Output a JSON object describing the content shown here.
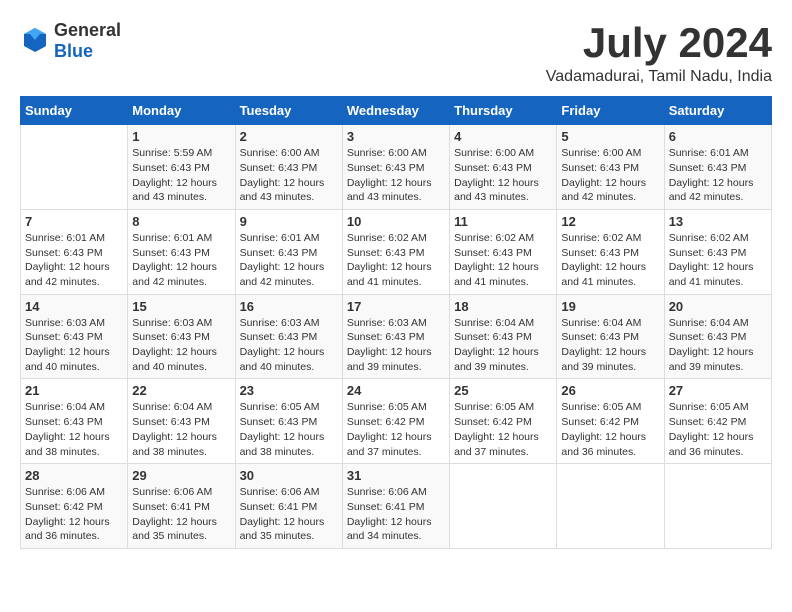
{
  "header": {
    "logo": {
      "general": "General",
      "blue": "Blue"
    },
    "title": "July 2024",
    "location": "Vadamadurai, Tamil Nadu, India"
  },
  "days_of_week": [
    "Sunday",
    "Monday",
    "Tuesday",
    "Wednesday",
    "Thursday",
    "Friday",
    "Saturday"
  ],
  "weeks": [
    [
      {
        "day": "",
        "sunrise": "",
        "sunset": "",
        "daylight": ""
      },
      {
        "day": "1",
        "sunrise": "Sunrise: 5:59 AM",
        "sunset": "Sunset: 6:43 PM",
        "daylight": "Daylight: 12 hours and 43 minutes."
      },
      {
        "day": "2",
        "sunrise": "Sunrise: 6:00 AM",
        "sunset": "Sunset: 6:43 PM",
        "daylight": "Daylight: 12 hours and 43 minutes."
      },
      {
        "day": "3",
        "sunrise": "Sunrise: 6:00 AM",
        "sunset": "Sunset: 6:43 PM",
        "daylight": "Daylight: 12 hours and 43 minutes."
      },
      {
        "day": "4",
        "sunrise": "Sunrise: 6:00 AM",
        "sunset": "Sunset: 6:43 PM",
        "daylight": "Daylight: 12 hours and 43 minutes."
      },
      {
        "day": "5",
        "sunrise": "Sunrise: 6:00 AM",
        "sunset": "Sunset: 6:43 PM",
        "daylight": "Daylight: 12 hours and 42 minutes."
      },
      {
        "day": "6",
        "sunrise": "Sunrise: 6:01 AM",
        "sunset": "Sunset: 6:43 PM",
        "daylight": "Daylight: 12 hours and 42 minutes."
      }
    ],
    [
      {
        "day": "7",
        "sunrise": "Sunrise: 6:01 AM",
        "sunset": "Sunset: 6:43 PM",
        "daylight": "Daylight: 12 hours and 42 minutes."
      },
      {
        "day": "8",
        "sunrise": "Sunrise: 6:01 AM",
        "sunset": "Sunset: 6:43 PM",
        "daylight": "Daylight: 12 hours and 42 minutes."
      },
      {
        "day": "9",
        "sunrise": "Sunrise: 6:01 AM",
        "sunset": "Sunset: 6:43 PM",
        "daylight": "Daylight: 12 hours and 42 minutes."
      },
      {
        "day": "10",
        "sunrise": "Sunrise: 6:02 AM",
        "sunset": "Sunset: 6:43 PM",
        "daylight": "Daylight: 12 hours and 41 minutes."
      },
      {
        "day": "11",
        "sunrise": "Sunrise: 6:02 AM",
        "sunset": "Sunset: 6:43 PM",
        "daylight": "Daylight: 12 hours and 41 minutes."
      },
      {
        "day": "12",
        "sunrise": "Sunrise: 6:02 AM",
        "sunset": "Sunset: 6:43 PM",
        "daylight": "Daylight: 12 hours and 41 minutes."
      },
      {
        "day": "13",
        "sunrise": "Sunrise: 6:02 AM",
        "sunset": "Sunset: 6:43 PM",
        "daylight": "Daylight: 12 hours and 41 minutes."
      }
    ],
    [
      {
        "day": "14",
        "sunrise": "Sunrise: 6:03 AM",
        "sunset": "Sunset: 6:43 PM",
        "daylight": "Daylight: 12 hours and 40 minutes."
      },
      {
        "day": "15",
        "sunrise": "Sunrise: 6:03 AM",
        "sunset": "Sunset: 6:43 PM",
        "daylight": "Daylight: 12 hours and 40 minutes."
      },
      {
        "day": "16",
        "sunrise": "Sunrise: 6:03 AM",
        "sunset": "Sunset: 6:43 PM",
        "daylight": "Daylight: 12 hours and 40 minutes."
      },
      {
        "day": "17",
        "sunrise": "Sunrise: 6:03 AM",
        "sunset": "Sunset: 6:43 PM",
        "daylight": "Daylight: 12 hours and 39 minutes."
      },
      {
        "day": "18",
        "sunrise": "Sunrise: 6:04 AM",
        "sunset": "Sunset: 6:43 PM",
        "daylight": "Daylight: 12 hours and 39 minutes."
      },
      {
        "day": "19",
        "sunrise": "Sunrise: 6:04 AM",
        "sunset": "Sunset: 6:43 PM",
        "daylight": "Daylight: 12 hours and 39 minutes."
      },
      {
        "day": "20",
        "sunrise": "Sunrise: 6:04 AM",
        "sunset": "Sunset: 6:43 PM",
        "daylight": "Daylight: 12 hours and 39 minutes."
      }
    ],
    [
      {
        "day": "21",
        "sunrise": "Sunrise: 6:04 AM",
        "sunset": "Sunset: 6:43 PM",
        "daylight": "Daylight: 12 hours and 38 minutes."
      },
      {
        "day": "22",
        "sunrise": "Sunrise: 6:04 AM",
        "sunset": "Sunset: 6:43 PM",
        "daylight": "Daylight: 12 hours and 38 minutes."
      },
      {
        "day": "23",
        "sunrise": "Sunrise: 6:05 AM",
        "sunset": "Sunset: 6:43 PM",
        "daylight": "Daylight: 12 hours and 38 minutes."
      },
      {
        "day": "24",
        "sunrise": "Sunrise: 6:05 AM",
        "sunset": "Sunset: 6:42 PM",
        "daylight": "Daylight: 12 hours and 37 minutes."
      },
      {
        "day": "25",
        "sunrise": "Sunrise: 6:05 AM",
        "sunset": "Sunset: 6:42 PM",
        "daylight": "Daylight: 12 hours and 37 minutes."
      },
      {
        "day": "26",
        "sunrise": "Sunrise: 6:05 AM",
        "sunset": "Sunset: 6:42 PM",
        "daylight": "Daylight: 12 hours and 36 minutes."
      },
      {
        "day": "27",
        "sunrise": "Sunrise: 6:05 AM",
        "sunset": "Sunset: 6:42 PM",
        "daylight": "Daylight: 12 hours and 36 minutes."
      }
    ],
    [
      {
        "day": "28",
        "sunrise": "Sunrise: 6:06 AM",
        "sunset": "Sunset: 6:42 PM",
        "daylight": "Daylight: 12 hours and 36 minutes."
      },
      {
        "day": "29",
        "sunrise": "Sunrise: 6:06 AM",
        "sunset": "Sunset: 6:41 PM",
        "daylight": "Daylight: 12 hours and 35 minutes."
      },
      {
        "day": "30",
        "sunrise": "Sunrise: 6:06 AM",
        "sunset": "Sunset: 6:41 PM",
        "daylight": "Daylight: 12 hours and 35 minutes."
      },
      {
        "day": "31",
        "sunrise": "Sunrise: 6:06 AM",
        "sunset": "Sunset: 6:41 PM",
        "daylight": "Daylight: 12 hours and 34 minutes."
      },
      {
        "day": "",
        "sunrise": "",
        "sunset": "",
        "daylight": ""
      },
      {
        "day": "",
        "sunrise": "",
        "sunset": "",
        "daylight": ""
      },
      {
        "day": "",
        "sunrise": "",
        "sunset": "",
        "daylight": ""
      }
    ]
  ]
}
